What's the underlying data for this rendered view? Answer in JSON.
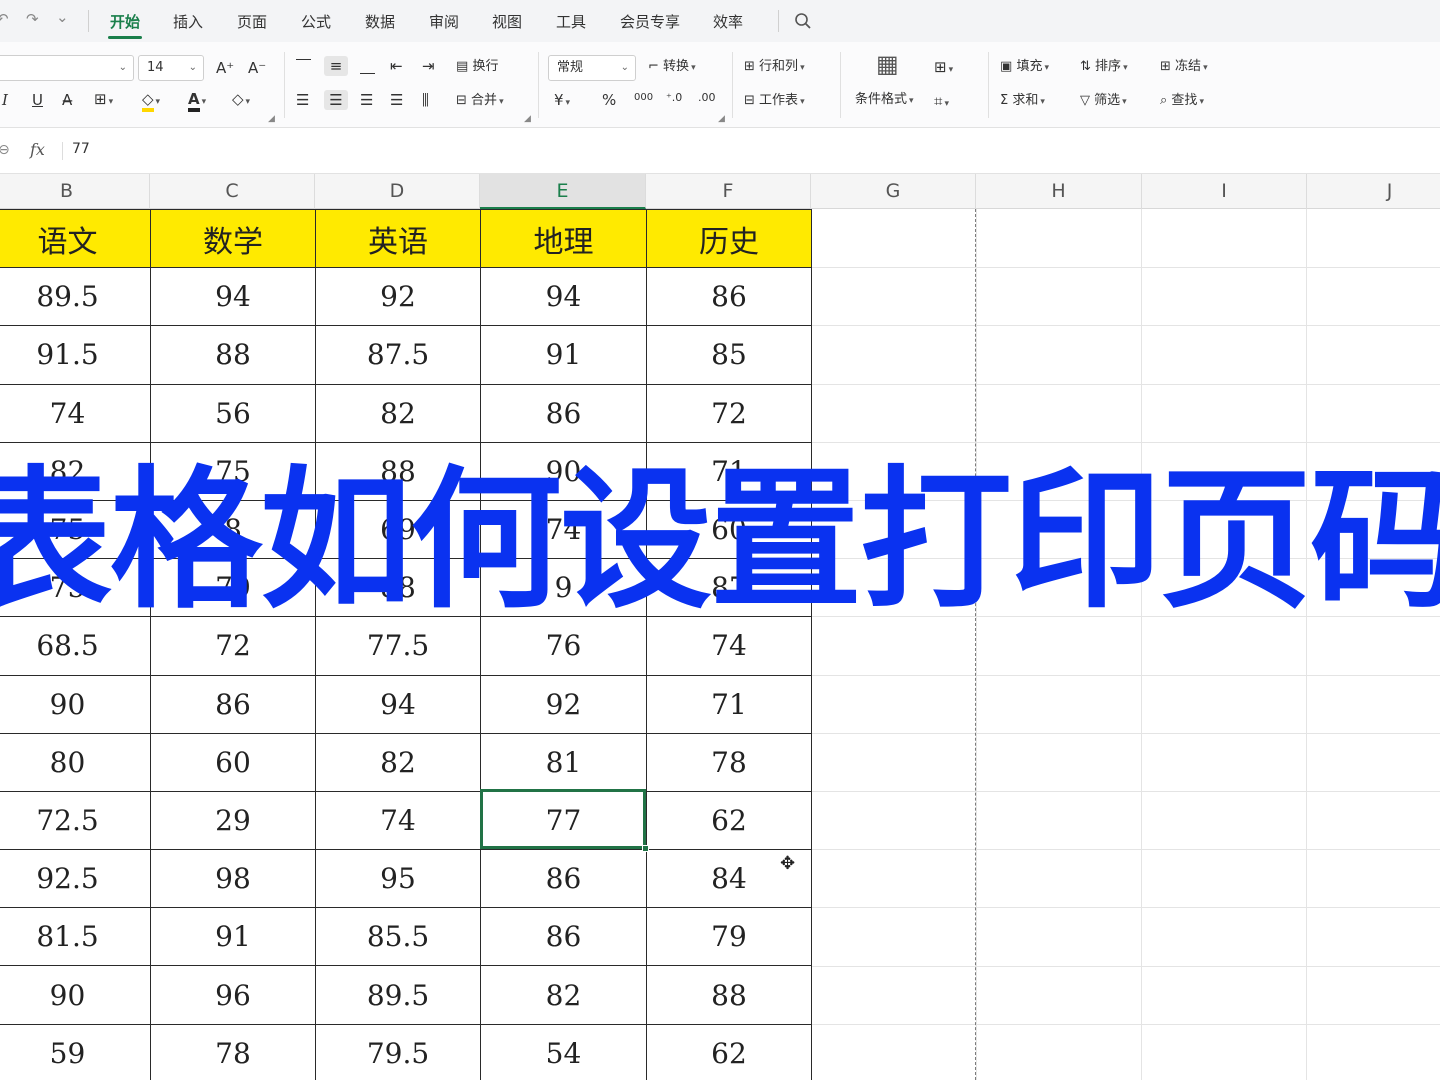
{
  "menubar": {
    "quick_access": {
      "undo": "↶",
      "redo": "↷",
      "more": "⌄"
    },
    "tabs": [
      {
        "label": "开始",
        "active": true
      },
      {
        "label": "插入"
      },
      {
        "label": "页面"
      },
      {
        "label": "公式"
      },
      {
        "label": "数据"
      },
      {
        "label": "审阅"
      },
      {
        "label": "视图"
      },
      {
        "label": "工具"
      },
      {
        "label": "会员专享"
      },
      {
        "label": "效率"
      }
    ]
  },
  "ribbon": {
    "font_size": "14",
    "font_name": "",
    "grow_font": "A⁺",
    "shrink_font": "A⁻",
    "italic": "I",
    "underline": "U",
    "strike": "A̶",
    "wrap_text": "换行",
    "merge": "合并",
    "number_format": "常规",
    "convert": "转换",
    "currency": "¥",
    "percent": "%",
    "thousands": "000",
    "inc_decimal": "⁺.0",
    "dec_decimal": ".00",
    "rows_cols": "行和列",
    "worksheet": "工作表",
    "conditional_format": "条件格式",
    "fill": "填充",
    "sort": "排序",
    "freeze": "冻结",
    "sum": "求和",
    "filter": "筛选",
    "find": "查找"
  },
  "formula_bar": {
    "fx": "fx",
    "value": "77"
  },
  "columns": [
    "B",
    "C",
    "D",
    "E",
    "F",
    "G",
    "H",
    "I",
    "J"
  ],
  "active_column": "E",
  "table": {
    "headers": [
      "语文",
      "数学",
      "英语",
      "地理",
      "历史"
    ],
    "rows": [
      [
        "89.5",
        "94",
        "92",
        "94",
        "86"
      ],
      [
        "91.5",
        "88",
        "87.5",
        "91",
        "85"
      ],
      [
        "74",
        "56",
        "82",
        "86",
        "72"
      ],
      [
        "82",
        "75",
        "88",
        "90",
        "71"
      ],
      [
        "75",
        "8",
        "69",
        "74",
        "60"
      ],
      [
        "75",
        "79",
        "88",
        "9",
        "87"
      ],
      [
        "68.5",
        "72",
        "77.5",
        "76",
        "74"
      ],
      [
        "90",
        "86",
        "94",
        "92",
        "71"
      ],
      [
        "80",
        "60",
        "82",
        "81",
        "78"
      ],
      [
        "72.5",
        "29",
        "74",
        "77",
        "62"
      ],
      [
        "92.5",
        "98",
        "95",
        "86",
        "84"
      ],
      [
        "81.5",
        "91",
        "85.5",
        "86",
        "79"
      ],
      [
        "90",
        "96",
        "89.5",
        "82",
        "88"
      ],
      [
        "59",
        "78",
        "79.5",
        "54",
        "62"
      ]
    ]
  },
  "overlay": {
    "title": "表格如何设置打印页码"
  },
  "colors": {
    "accent": "#1a7f4b",
    "header_fill": "#ffea00",
    "overlay_text": "#0a32f0",
    "selection": "#217346"
  }
}
